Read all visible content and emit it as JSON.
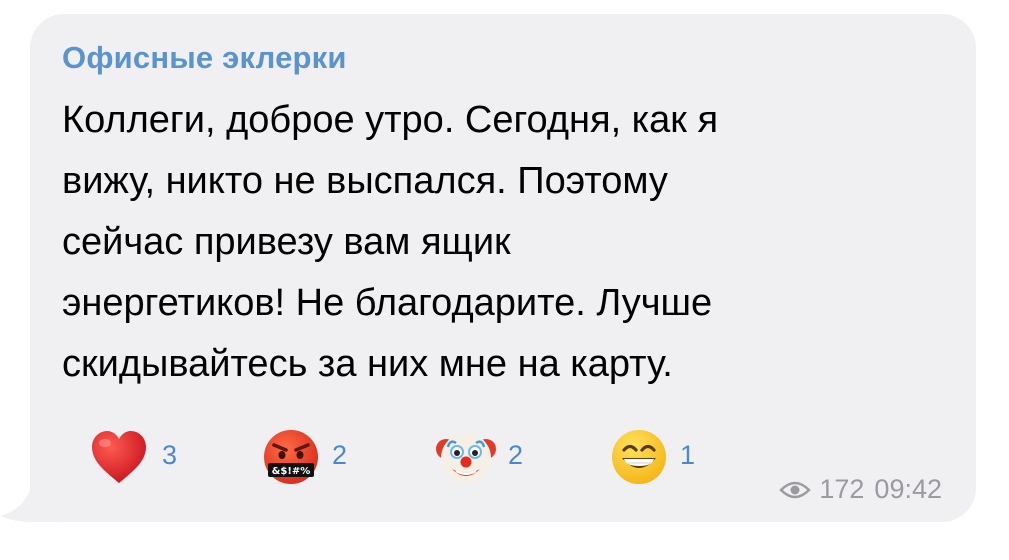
{
  "message": {
    "sender": "Офисные эклерки",
    "lines": [
      "Коллеги, доброе утро. Сегодня, как я",
      "вижу, никто не выспался. Поэтому",
      "сейчас привезу вам ящик",
      "энергетиков! Не благодарите. Лучше",
      "скидывайтесь за них мне на карту."
    ],
    "views": "172",
    "time": "09:42"
  },
  "reactions": [
    {
      "emoji": "red-heart",
      "count": "3"
    },
    {
      "emoji": "face-with-symbols-on-mouth",
      "symbols": "&$!#%",
      "count": "2"
    },
    {
      "emoji": "clown-face",
      "count": "2"
    },
    {
      "emoji": "grinning-face",
      "count": "1"
    }
  ],
  "colors": {
    "bubble": "#f0f0f3",
    "sender": "#5a93cd",
    "reaction_count": "#4a88cf",
    "meta": "#9a9aa0"
  }
}
